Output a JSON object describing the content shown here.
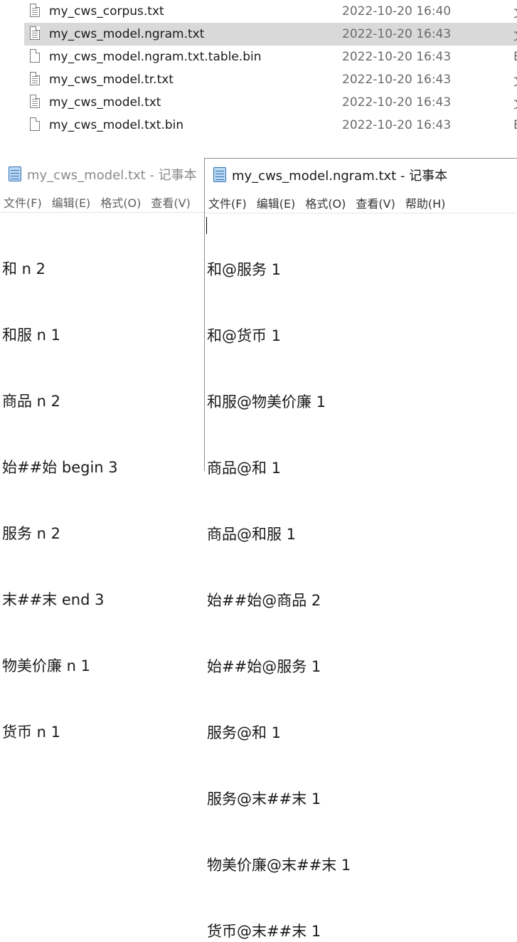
{
  "explorer": {
    "files": [
      {
        "name": "my_cws_corpus.txt",
        "date": "2022-10-20 16:40",
        "type": "文",
        "icon": "text-file-icon"
      },
      {
        "name": "my_cws_model.ngram.txt",
        "date": "2022-10-20 16:43",
        "type": "文",
        "icon": "text-file-icon",
        "selected": true
      },
      {
        "name": "my_cws_model.ngram.txt.table.bin",
        "date": "2022-10-20 16:43",
        "type": "B",
        "icon": "blank-file-icon"
      },
      {
        "name": "my_cws_model.tr.txt",
        "date": "2022-10-20 16:43",
        "type": "文",
        "icon": "text-file-icon"
      },
      {
        "name": "my_cws_model.txt",
        "date": "2022-10-20 16:43",
        "type": "文",
        "icon": "text-file-icon"
      },
      {
        "name": "my_cws_model.txt.bin",
        "date": "2022-10-20 16:43",
        "type": "B",
        "icon": "blank-file-icon"
      }
    ]
  },
  "notepad_left": {
    "title": "my_cws_model.txt - 记事本",
    "menu": [
      "文件(F)",
      "编辑(E)",
      "格式(O)",
      "查看(V)"
    ],
    "lines": [
      "和 n 2",
      "和服 n 1",
      "商品 n 2",
      "始##始 begin 3",
      "服务 n 2",
      "末##末 end 3",
      "物美价廉 n 1",
      "货币 n 1"
    ]
  },
  "notepad_right": {
    "title": "my_cws_model.ngram.txt - 记事本",
    "menu": [
      "文件(F)",
      "编辑(E)",
      "格式(O)",
      "查看(V)",
      "帮助(H)"
    ],
    "lines": [
      "和@服务 1",
      "和@货币 1",
      "和服@物美价廉 1",
      "商品@和 1",
      "商品@和服 1",
      "始##始@商品 2",
      "始##始@服务 1",
      "服务@和 1",
      "服务@末##末 1",
      "物美价廉@末##末 1",
      "货币@末##末 1"
    ]
  }
}
